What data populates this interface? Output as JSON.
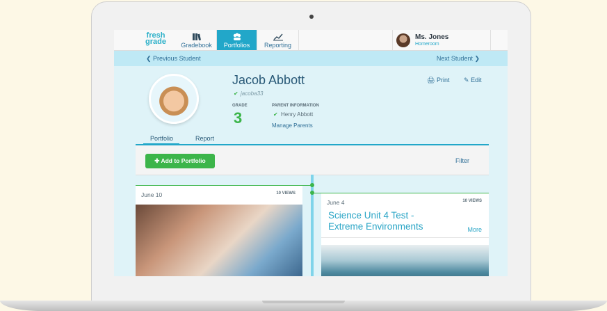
{
  "nav": {
    "logo_line1": "fresh",
    "logo_line2": "grade",
    "gradebook": "Gradebook",
    "portfolios": "Portfolios",
    "reporting": "Reporting"
  },
  "user": {
    "name": "Ms. Jones",
    "role": "Homeroom"
  },
  "student_nav": {
    "prev": "Previous Student",
    "next": "Next Student"
  },
  "student": {
    "name": "Jacob Abbott",
    "username": "jacoba33",
    "grade_label": "GRADE",
    "grade": "3",
    "parent_label": "PARENT INFORMATION",
    "parent_name": "Henry Abbott",
    "manage_parents": "Manage Parents"
  },
  "actions": {
    "print": "Print",
    "edit": "Edit"
  },
  "tabs": {
    "portfolio": "Portfolio",
    "report": "Report"
  },
  "panel": {
    "add": "Add to Portfolio",
    "filter": "Filter"
  },
  "cards": [
    {
      "date": "June 10",
      "views": "10 VIEWS"
    },
    {
      "date": "June 4",
      "views": "10 VIEWS",
      "title": "Science Unit 4 Test - Extreme Environments",
      "more": "More"
    }
  ],
  "colors": {
    "accent": "#22a7c9",
    "green": "#3cb54a",
    "link": "#2f6f97"
  }
}
